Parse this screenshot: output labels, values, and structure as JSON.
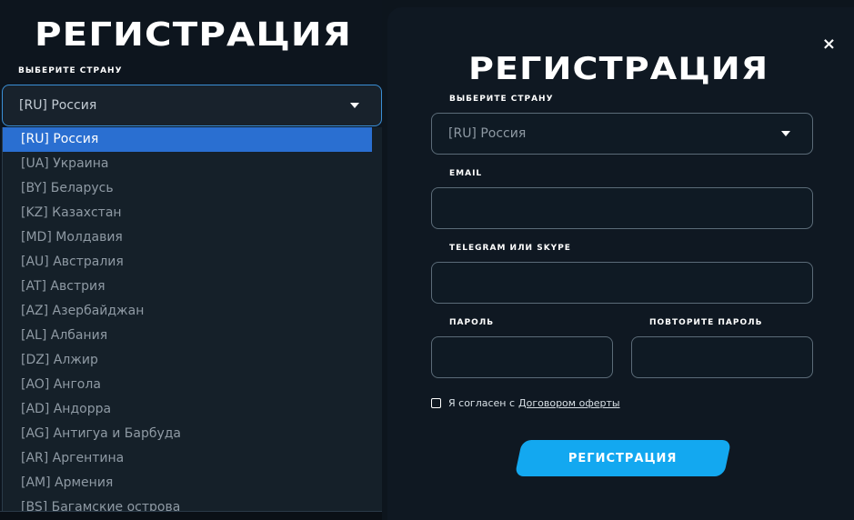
{
  "left": {
    "title": "РЕГИСТРАЦИЯ",
    "country_label": "ВЫБЕРИТЕ СТРАНУ",
    "country_value": "[RU] Россия",
    "options": [
      "[RU] Россия",
      "[UA] Украина",
      "[BY] Беларусь",
      "[KZ] Казахстан",
      "[MD] Молдавия",
      "[AU] Австралия",
      "[AT] Австрия",
      "[AZ] Азербайджан",
      "[AL] Албания",
      "[DZ] Алжир",
      "[AO] Ангола",
      "[AD] Андорра",
      "[AG] Антигуа и Барбуда",
      "[AR] Аргентина",
      "[AM] Армения",
      "[BS] Багамские острова"
    ],
    "selected_index": 0
  },
  "right": {
    "close": "×",
    "title": "РЕГИСТРАЦИЯ",
    "country_label": "ВЫБЕРИТЕ СТРАНУ",
    "country_value": "[RU] Россия",
    "email_label": "EMAIL",
    "email_value": "",
    "messenger_label": "TELEGRAM ИЛИ SKYPE",
    "messenger_value": "",
    "password_label": "ПАРОЛЬ",
    "password_value": "",
    "password_repeat_label": "ПОВТОРИТЕ ПАРОЛЬ",
    "password_repeat_value": "",
    "consent_text": "Я согласен с",
    "consent_link": "Договором оферты",
    "submit_label": "РЕГИСТРАЦИЯ"
  },
  "colors": {
    "accent": "#13a8f0",
    "selected_option": "#2a6fd1",
    "background": "#0f1822"
  }
}
